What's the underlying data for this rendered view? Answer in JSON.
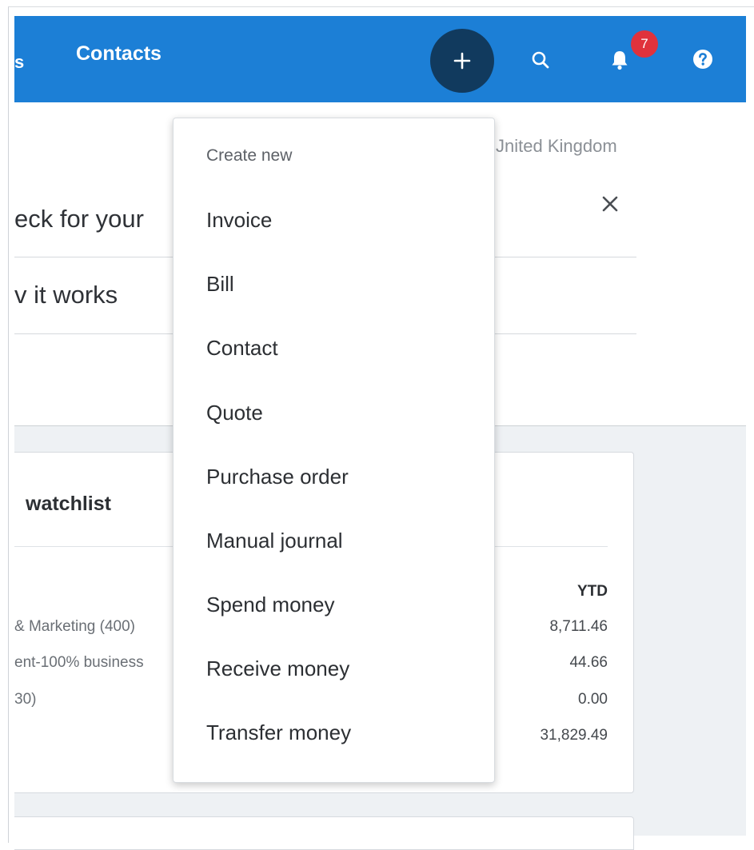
{
  "nav": {
    "clipped_text": "s",
    "contacts_label": "Contacts",
    "notification_count": "7",
    "accent": "#1c7fd6",
    "plus_button_color": "#113a5e",
    "badge_color": "#e0323c",
    "icons": [
      "plus-icon",
      "search-icon",
      "bell-icon",
      "help-icon"
    ]
  },
  "page": {
    "org_country": "Jnited Kingdom",
    "banner_line1": "eck for your",
    "banner_line2": "v it works",
    "close_icon": "close-icon"
  },
  "watchlist": {
    "title": "watchlist",
    "column_header": "YTD",
    "rows": [
      {
        "label": "& Marketing (400)",
        "value": "8,711.46"
      },
      {
        "label": "ent-100% business",
        "value": "44.66"
      },
      {
        "label": "30)",
        "value": "0.00"
      },
      {
        "label": "",
        "value": "31,829.49"
      }
    ]
  },
  "menu": {
    "heading": "Create new",
    "items": [
      "Invoice",
      "Bill",
      "Contact",
      "Quote",
      "Purchase order",
      "Manual journal",
      "Spend money",
      "Receive money",
      "Transfer money"
    ]
  }
}
